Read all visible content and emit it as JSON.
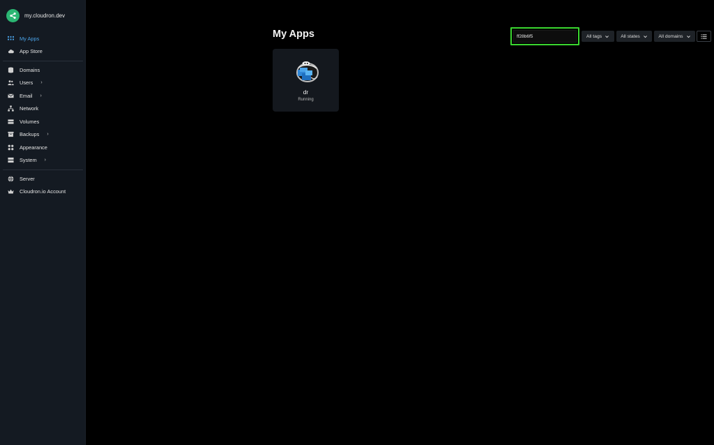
{
  "brand": {
    "name": "my.cloudron.dev"
  },
  "nav": {
    "group1": [
      {
        "label": "My Apps",
        "icon": "grid-icon",
        "active": true
      },
      {
        "label": "App Store",
        "icon": "cloud-icon"
      }
    ],
    "group2": [
      {
        "label": "Domains",
        "icon": "database-icon"
      },
      {
        "label": "Users",
        "icon": "users-icon",
        "chevron": true
      },
      {
        "label": "Email",
        "icon": "envelope-icon",
        "chevron": true
      },
      {
        "label": "Network",
        "icon": "network-icon"
      },
      {
        "label": "Volumes",
        "icon": "hdd-icon"
      },
      {
        "label": "Backups",
        "icon": "archive-icon",
        "chevron": true
      },
      {
        "label": "Appearance",
        "icon": "palette-icon"
      },
      {
        "label": "System",
        "icon": "server-icon",
        "chevron": true
      }
    ],
    "group3": [
      {
        "label": "Server",
        "icon": "globe-icon"
      },
      {
        "label": "Cloudron.io Account",
        "icon": "crown-icon"
      }
    ]
  },
  "page": {
    "title": "My Apps"
  },
  "search": {
    "value": "ff28b6f5"
  },
  "filters": {
    "tags": "All tags",
    "states": "All states",
    "domains": "All domains"
  },
  "apps": [
    {
      "name": "dr",
      "status": "Running"
    }
  ],
  "colors": {
    "sidebar_bg": "#141a22",
    "accent_active": "#4aa3e8",
    "brand_green": "#2bb673",
    "search_highlight": "#3ad62f"
  }
}
